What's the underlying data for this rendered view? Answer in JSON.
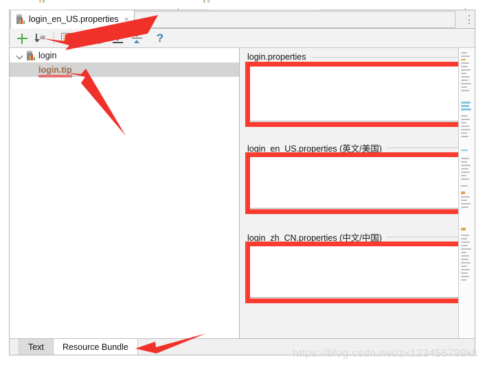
{
  "window": {
    "editor_tab": {
      "label": "login_en_US.properties",
      "icon": "properties-file-icon",
      "close": "×"
    }
  },
  "toolbar": {
    "buttons": [
      {
        "name": "add-property-button",
        "icon": "plus-icon",
        "label": "+"
      },
      {
        "name": "sort-alphabetically-button",
        "icon": "sort-az-icon",
        "label": "↓z"
      },
      {
        "name": "group-by-prefix-button",
        "icon": "list-properties-icon",
        "label": ""
      },
      {
        "name": "group-by-prefix-dropdown",
        "icon": "chevron-down-icon",
        "label": ""
      },
      {
        "name": "settings-button",
        "icon": "properties-settings-icon",
        "label": ""
      },
      {
        "name": "expand-all-button",
        "icon": "expand-all-icon",
        "label": ""
      },
      {
        "name": "collapse-all-button",
        "icon": "collapse-all-icon",
        "label": ""
      },
      {
        "name": "help-button",
        "icon": "question-mark-icon",
        "label": "?"
      }
    ]
  },
  "tree": {
    "root": {
      "label": "login",
      "icon": "properties-file-icon",
      "expanded": true,
      "chevron": "chevron-down-icon"
    },
    "items": [
      {
        "label": "login.tip",
        "selected": true,
        "has_error_underline": true
      }
    ]
  },
  "detail": {
    "groups": [
      {
        "title": "login.properties",
        "value": "",
        "highlighted": true
      },
      {
        "title": "login_en_US.properties (英文/美国)",
        "value": "",
        "highlighted": true
      },
      {
        "title": "login_zh_CN.properties (中文/中国)",
        "value": "",
        "highlighted": true
      }
    ]
  },
  "bottom_tabs": [
    {
      "label": "Text",
      "active": false
    },
    {
      "label": "Resource Bundle",
      "active": true
    }
  ],
  "watermark": "https://blog.csdn.net/zx123456789kk",
  "colors": {
    "highlight": "#fb3b2f",
    "arrow": "#f03129",
    "accent_green": "#49a942",
    "accent_blue": "#4a90c4",
    "selection": "#d4d4d4",
    "key_text": "#9a6a4a"
  }
}
